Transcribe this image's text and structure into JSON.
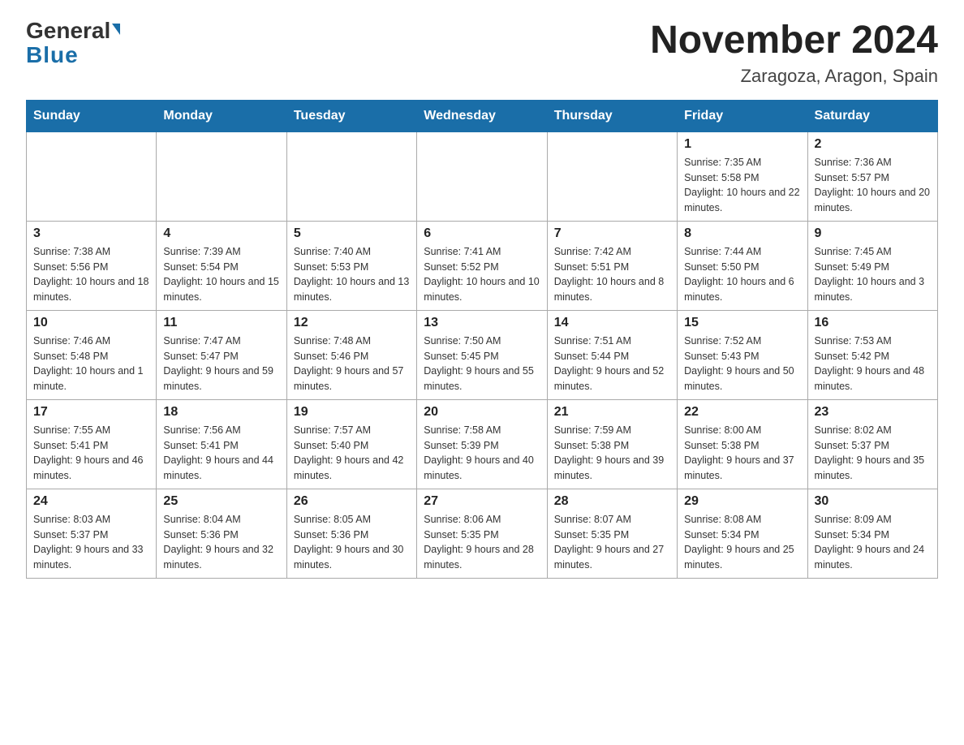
{
  "logo": {
    "general": "General",
    "blue": "Blue"
  },
  "title": "November 2024",
  "subtitle": "Zaragoza, Aragon, Spain",
  "days_of_week": [
    "Sunday",
    "Monday",
    "Tuesday",
    "Wednesday",
    "Thursday",
    "Friday",
    "Saturday"
  ],
  "weeks": [
    [
      {
        "day": "",
        "info": ""
      },
      {
        "day": "",
        "info": ""
      },
      {
        "day": "",
        "info": ""
      },
      {
        "day": "",
        "info": ""
      },
      {
        "day": "",
        "info": ""
      },
      {
        "day": "1",
        "info": "Sunrise: 7:35 AM\nSunset: 5:58 PM\nDaylight: 10 hours and 22 minutes."
      },
      {
        "day": "2",
        "info": "Sunrise: 7:36 AM\nSunset: 5:57 PM\nDaylight: 10 hours and 20 minutes."
      }
    ],
    [
      {
        "day": "3",
        "info": "Sunrise: 7:38 AM\nSunset: 5:56 PM\nDaylight: 10 hours and 18 minutes."
      },
      {
        "day": "4",
        "info": "Sunrise: 7:39 AM\nSunset: 5:54 PM\nDaylight: 10 hours and 15 minutes."
      },
      {
        "day": "5",
        "info": "Sunrise: 7:40 AM\nSunset: 5:53 PM\nDaylight: 10 hours and 13 minutes."
      },
      {
        "day": "6",
        "info": "Sunrise: 7:41 AM\nSunset: 5:52 PM\nDaylight: 10 hours and 10 minutes."
      },
      {
        "day": "7",
        "info": "Sunrise: 7:42 AM\nSunset: 5:51 PM\nDaylight: 10 hours and 8 minutes."
      },
      {
        "day": "8",
        "info": "Sunrise: 7:44 AM\nSunset: 5:50 PM\nDaylight: 10 hours and 6 minutes."
      },
      {
        "day": "9",
        "info": "Sunrise: 7:45 AM\nSunset: 5:49 PM\nDaylight: 10 hours and 3 minutes."
      }
    ],
    [
      {
        "day": "10",
        "info": "Sunrise: 7:46 AM\nSunset: 5:48 PM\nDaylight: 10 hours and 1 minute."
      },
      {
        "day": "11",
        "info": "Sunrise: 7:47 AM\nSunset: 5:47 PM\nDaylight: 9 hours and 59 minutes."
      },
      {
        "day": "12",
        "info": "Sunrise: 7:48 AM\nSunset: 5:46 PM\nDaylight: 9 hours and 57 minutes."
      },
      {
        "day": "13",
        "info": "Sunrise: 7:50 AM\nSunset: 5:45 PM\nDaylight: 9 hours and 55 minutes."
      },
      {
        "day": "14",
        "info": "Sunrise: 7:51 AM\nSunset: 5:44 PM\nDaylight: 9 hours and 52 minutes."
      },
      {
        "day": "15",
        "info": "Sunrise: 7:52 AM\nSunset: 5:43 PM\nDaylight: 9 hours and 50 minutes."
      },
      {
        "day": "16",
        "info": "Sunrise: 7:53 AM\nSunset: 5:42 PM\nDaylight: 9 hours and 48 minutes."
      }
    ],
    [
      {
        "day": "17",
        "info": "Sunrise: 7:55 AM\nSunset: 5:41 PM\nDaylight: 9 hours and 46 minutes."
      },
      {
        "day": "18",
        "info": "Sunrise: 7:56 AM\nSunset: 5:41 PM\nDaylight: 9 hours and 44 minutes."
      },
      {
        "day": "19",
        "info": "Sunrise: 7:57 AM\nSunset: 5:40 PM\nDaylight: 9 hours and 42 minutes."
      },
      {
        "day": "20",
        "info": "Sunrise: 7:58 AM\nSunset: 5:39 PM\nDaylight: 9 hours and 40 minutes."
      },
      {
        "day": "21",
        "info": "Sunrise: 7:59 AM\nSunset: 5:38 PM\nDaylight: 9 hours and 39 minutes."
      },
      {
        "day": "22",
        "info": "Sunrise: 8:00 AM\nSunset: 5:38 PM\nDaylight: 9 hours and 37 minutes."
      },
      {
        "day": "23",
        "info": "Sunrise: 8:02 AM\nSunset: 5:37 PM\nDaylight: 9 hours and 35 minutes."
      }
    ],
    [
      {
        "day": "24",
        "info": "Sunrise: 8:03 AM\nSunset: 5:37 PM\nDaylight: 9 hours and 33 minutes."
      },
      {
        "day": "25",
        "info": "Sunrise: 8:04 AM\nSunset: 5:36 PM\nDaylight: 9 hours and 32 minutes."
      },
      {
        "day": "26",
        "info": "Sunrise: 8:05 AM\nSunset: 5:36 PM\nDaylight: 9 hours and 30 minutes."
      },
      {
        "day": "27",
        "info": "Sunrise: 8:06 AM\nSunset: 5:35 PM\nDaylight: 9 hours and 28 minutes."
      },
      {
        "day": "28",
        "info": "Sunrise: 8:07 AM\nSunset: 5:35 PM\nDaylight: 9 hours and 27 minutes."
      },
      {
        "day": "29",
        "info": "Sunrise: 8:08 AM\nSunset: 5:34 PM\nDaylight: 9 hours and 25 minutes."
      },
      {
        "day": "30",
        "info": "Sunrise: 8:09 AM\nSunset: 5:34 PM\nDaylight: 9 hours and 24 minutes."
      }
    ]
  ]
}
